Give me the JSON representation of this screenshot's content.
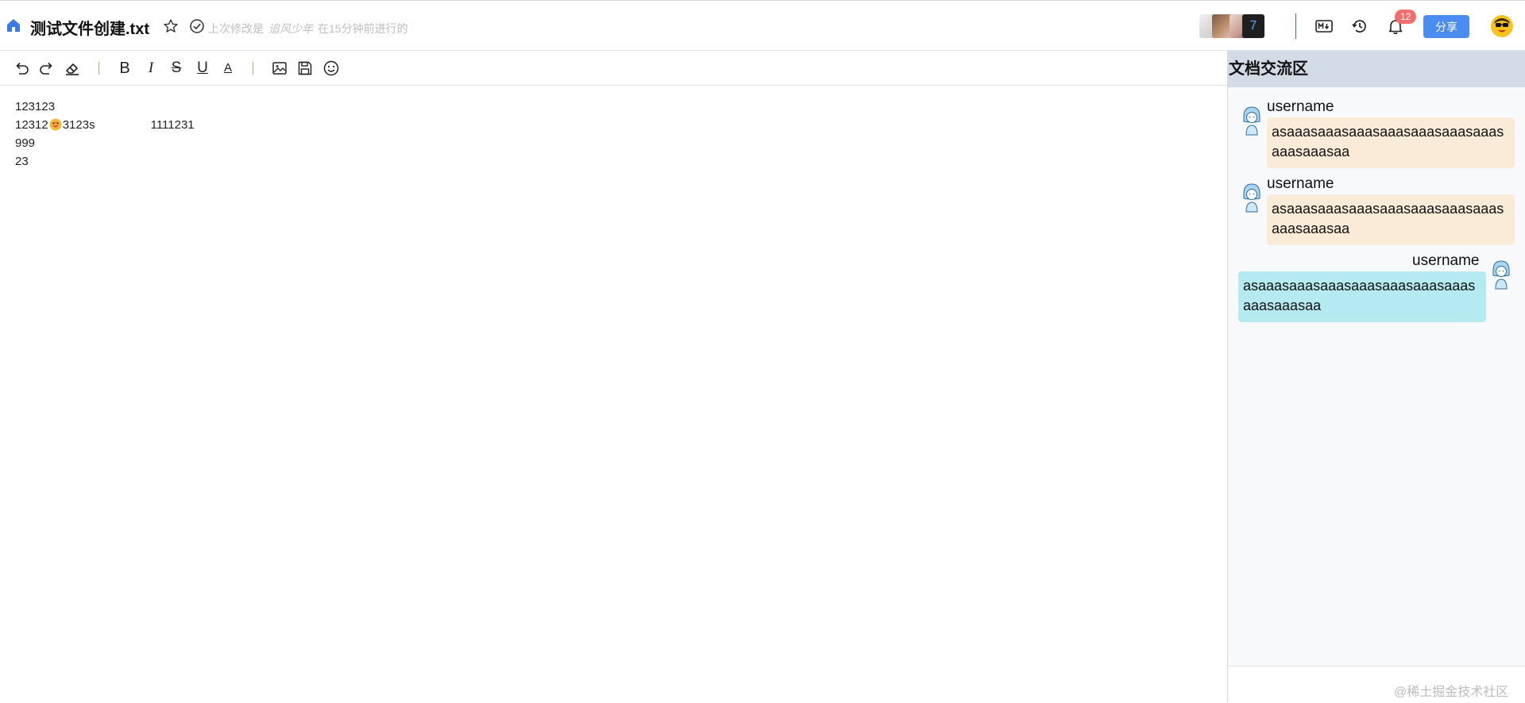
{
  "header": {
    "title": "测试文件创建.txt",
    "modified_prefix": "上次修改是",
    "modified_by": "追风少年",
    "modified_suffix": "在15分钟前进行的",
    "collaborators_more": "7",
    "notification_count": "12",
    "share_label": "分享",
    "icons": [
      "home-icon",
      "star-icon",
      "check-circle-icon",
      "markdown-icon",
      "history-icon",
      "bell-icon"
    ]
  },
  "toolbar": {
    "bold": "B",
    "italic": "I",
    "strike": "S",
    "underline": "U",
    "font_color": "A",
    "icons": [
      "undo-icon",
      "redo-icon",
      "eraser-icon",
      "bold-icon",
      "italic-icon",
      "strikethrough-icon",
      "underline-icon",
      "font-color-icon",
      "image-icon",
      "save-icon",
      "emoji-icon"
    ]
  },
  "editor": {
    "lines": [
      "123123",
      "12312",
      "3123s",
      "1111231",
      "999",
      "23"
    ]
  },
  "chat": {
    "title": "文档交流区",
    "messages": [
      {
        "name": "username",
        "text": "asaaasaaasaaasaaasaaasaaasaaasaaasaaasaa",
        "side": "left"
      },
      {
        "name": "username",
        "text": "asaaasaaasaaasaaasaaasaaasaaasaaasaaasaa",
        "side": "left"
      },
      {
        "name": "username",
        "text": "asaaasaaasaaasaaasaaasaaasaaasaaasaaasaa",
        "side": "right"
      }
    ]
  },
  "watermark": "@稀土掘金技术社区",
  "colors": {
    "accent": "#4a8cf0",
    "badge": "#f56c6c",
    "chat_header": "#d3dce6",
    "bubble_in": "#faebd8",
    "bubble_out": "#b5ebf0"
  }
}
